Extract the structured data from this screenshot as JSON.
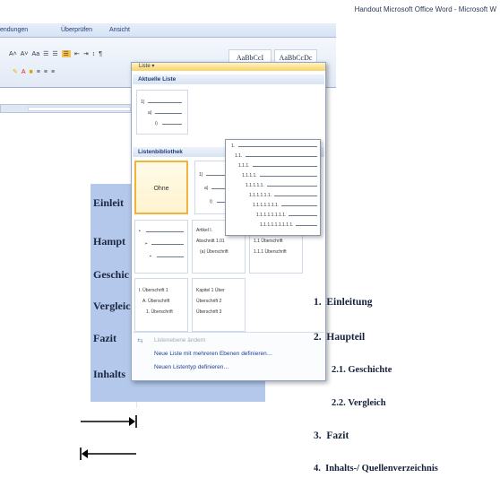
{
  "window": {
    "title": "Handout Microsoft Office Word - Microsoft W"
  },
  "ribbon": {
    "tabs": [
      "endungen",
      "Überprüfen",
      "Ansicht"
    ],
    "row1": [
      "A˄",
      "A˅",
      "Aa",
      "☰",
      "☰",
      "☰",
      "⇤",
      "⇥",
      "↕",
      "¶"
    ],
    "row2": [
      "≡",
      "≡",
      "≡"
    ],
    "styles": [
      "AaBbCcI",
      "AaBbCcDc"
    ]
  },
  "dropdown": {
    "top_label": "Liste ▾",
    "section_current": "Aktuelle Liste",
    "section_library": "Listenbibliothek",
    "none_label": "Ohne",
    "tiles": [
      {
        "lines": [
          "1)",
          "a)",
          "i)"
        ]
      },
      {
        "lines": [
          "•",
          "➢",
          "▪"
        ]
      },
      {
        "lines": [
          "Artikel I.",
          "Abschnitt 1.01",
          "(a) Überschrift"
        ]
      },
      {
        "lines": [
          "1.1 Überschrift",
          "1.1.1 Überschrift"
        ]
      },
      {
        "lines": [
          "I. Überschrift 1",
          "A. Überschrift",
          "1. Überschrift"
        ]
      },
      {
        "lines": [
          "Kapitel 1 Über",
          "Überschrift 2",
          "Überschrift 3"
        ]
      }
    ],
    "preview_lines": [
      "1.",
      "1.1.",
      "1.1.1.",
      "1.1.1.1.",
      "1.1.1.1.1.",
      "1.1.1.1.1.1.",
      "1.1.1.1.1.1.1.",
      "1.1.1.1.1.1.1.1.",
      "1.1.1.1.1.1.1.1.1."
    ],
    "menu": [
      {
        "label": "Listenebene ändern",
        "enabled": false
      },
      {
        "label": "Neue Liste mit mehreren Ebenen definieren…",
        "enabled": true
      },
      {
        "label": "Neuen Listentyp definieren…",
        "enabled": true
      }
    ]
  },
  "document": {
    "highlighted": [
      "Einleit",
      "Hampt",
      "Geschic",
      "Vergleic",
      "Fazit",
      "Inhalts"
    ]
  },
  "outline": [
    {
      "num": "1.",
      "text": "Einleitung"
    },
    {
      "num": "2.",
      "text": "Haupteil"
    },
    {
      "num": "2.1.",
      "text": "Geschichte"
    },
    {
      "num": "2.2.",
      "text": "Vergleich"
    },
    {
      "num": "3.",
      "text": "Fazit"
    },
    {
      "num": "4.",
      "text": "Inhalts-/ Quellenverzeichnis"
    }
  ]
}
